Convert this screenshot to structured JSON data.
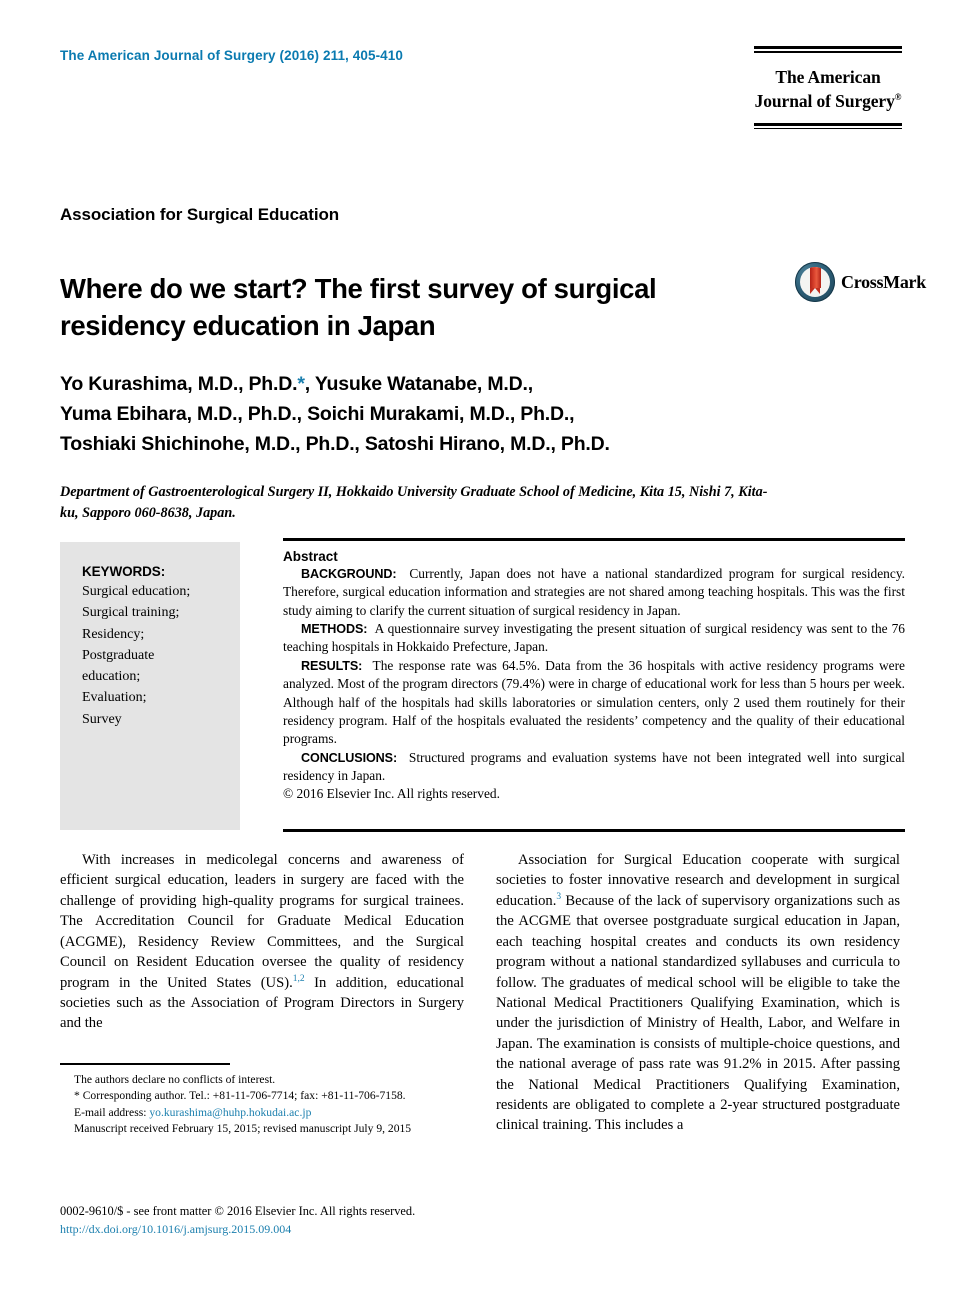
{
  "header": {
    "journal_reference": "The American Journal of Surgery (2016) 211, 405-410",
    "logo_line1": "The American",
    "logo_line2": "Journal of Surgery",
    "logo_registered": "®",
    "accent_color": "#0a7ab0"
  },
  "article": {
    "section_label": "Association for Surgical Education",
    "title": "Where do we start? The first survey of surgical residency education in Japan",
    "crossmark_label": "CrossMark",
    "authors_line1": "Yo Kurashima, M.D., Ph.D.",
    "authors_star": "*",
    "authors_line1_cont": ", Yusuke Watanabe, M.D.,",
    "authors_line2": "Yuma Ebihara, M.D., Ph.D., Soichi Murakami, M.D., Ph.D.,",
    "authors_line3": "Toshiaki Shichinohe, M.D., Ph.D., Satoshi Hirano, M.D., Ph.D.",
    "affiliation": "Department of Gastroenterological Surgery II, Hokkaido University Graduate School of Medicine, Kita 15, Nishi 7, Kita-ku, Sapporo 060-8638, Japan."
  },
  "keywords": {
    "title": "KEYWORDS:",
    "items": [
      "Surgical education;",
      "Surgical training;",
      "Residency;",
      "Postgraduate",
      "education;",
      "Evaluation;",
      "Survey"
    ]
  },
  "abstract": {
    "title": "Abstract",
    "background_label": "BACKGROUND:",
    "background_text": "Currently, Japan does not have a national standardized program for surgical residency. Therefore, surgical education information and strategies are not shared among teaching hospitals. This was the first study aiming to clarify the current situation of surgical residency in Japan.",
    "methods_label": "METHODS:",
    "methods_text": "A questionnaire survey investigating the present situation of surgical residency was sent to the 76 teaching hospitals in Hokkaido Prefecture, Japan.",
    "results_label": "RESULTS:",
    "results_text": "The response rate was 64.5%. Data from the 36 hospitals with active residency programs were analyzed. Most of the program directors (79.4%) were in charge of educational work for less than 5 hours per week. Although half of the hospitals had skills laboratories or simulation centers, only 2 used them routinely for their residency program. Half of the hospitals evaluated the residents’ competency and the quality of their educational programs.",
    "conclusions_label": "CONCLUSIONS:",
    "conclusions_text": "Structured programs and evaluation systems have not been integrated well into surgical residency in Japan.",
    "copyright": "© 2016 Elsevier Inc. All rights reserved."
  },
  "body": {
    "left_column_part1": "With increases in medicolegal concerns and awareness of efficient surgical education, leaders in surgery are faced with the challenge of providing high-quality programs for surgical trainees. The Accreditation Council for Graduate Medical Education (ACGME), Residency Review Committees, and the Surgical Council on Resident Education oversee the quality of residency program in the United States (US).",
    "left_citation": "1,2",
    "left_column_part2": " In addition, educational societies such as the Association of Program Directors in Surgery and the",
    "right_column_part1": "Association for Surgical Education cooperate with surgical societies to foster innovative research and development in surgical education.",
    "right_citation": "3",
    "right_column_part2": " Because of the lack of supervisory organizations such as the ACGME that oversee postgraduate surgical education in Japan, each teaching hospital creates and conducts its own residency program without a national standardized syllabuses and curricula to follow. The graduates of medical school will be eligible to take the National Medical Practitioners Qualifying Examination, which is under the jurisdiction of Ministry of Health, Labor, and Welfare in Japan. The examination is consists of multiple-choice questions, and the national average of pass rate was 91.2% in 2015. After passing the National Medical Practitioners Qualifying Examination, residents are obligated to complete a 2-year structured postgraduate clinical training. This includes a"
  },
  "footnotes": {
    "conflicts": "The authors declare no conflicts of interest.",
    "corresponding": "* Corresponding author. Tel.: +81-11-706-7714; fax: +81-11-706-7158.",
    "email_label": "E-mail address:",
    "email": "yo.kurashima@huhp.hokudai.ac.jp",
    "manuscript": "Manuscript received February 15, 2015; revised manuscript July 9, 2015"
  },
  "footer": {
    "issn_line": "0002-9610/$ - see front matter © 2016 Elsevier Inc. All rights reserved.",
    "doi": "http://dx.doi.org/10.1016/j.amjsurg.2015.09.004"
  }
}
